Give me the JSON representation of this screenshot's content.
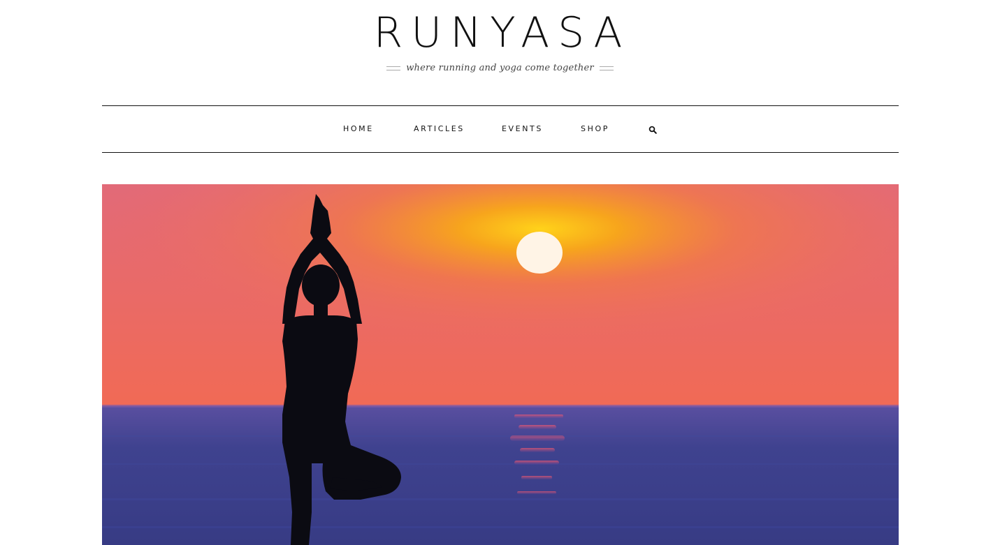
{
  "header": {
    "site_title": "RUNYASA",
    "tagline": "where running and yoga come together"
  },
  "nav": {
    "items": [
      {
        "label": "HOME"
      },
      {
        "label": "ARTICLES"
      },
      {
        "label": "EVENTS"
      },
      {
        "label": "SHOP"
      }
    ],
    "search_icon": "search-icon"
  },
  "hero": {
    "image": "yoga-tree-pose-silhouette-sunset-ocean",
    "colors": {
      "sky_top": "#e06a78",
      "sky_glow": "#f59a1e",
      "sun": "#fff3e0",
      "sea": "#3f3f8f",
      "silhouette": "#0b0b12"
    }
  }
}
